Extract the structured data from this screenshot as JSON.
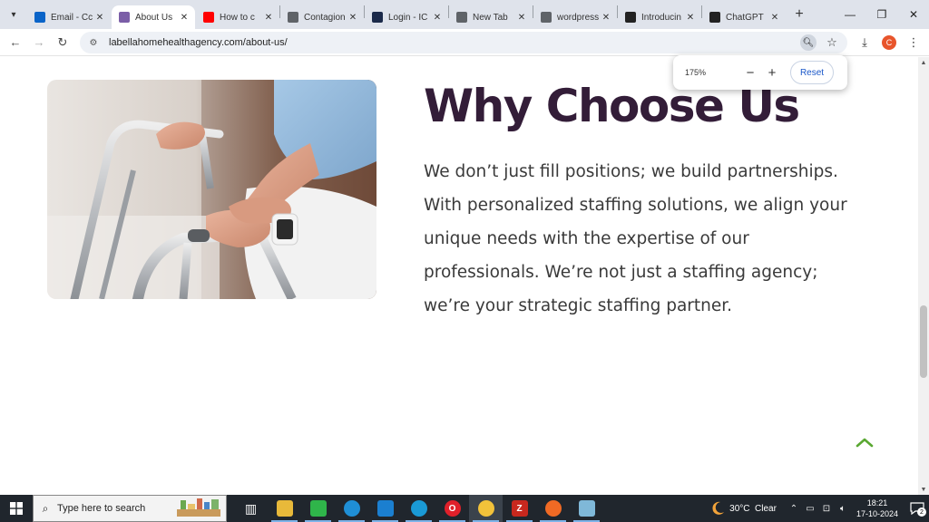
{
  "browser": {
    "tabs": [
      {
        "label": "Email - Cc",
        "favicon": "outlook-icon",
        "color": "#0a64c8",
        "active": false
      },
      {
        "label": "About Us",
        "favicon": "lotus-logo-icon",
        "color": "#7b5ea7",
        "active": true
      },
      {
        "label": "How to c",
        "favicon": "youtube-icon",
        "color": "#ff0000",
        "active": false
      },
      {
        "label": "Contagion",
        "favicon": "globe-icon",
        "color": "#5f6368",
        "active": false
      },
      {
        "label": "Login - IC",
        "favicon": "n-logo-icon",
        "color": "#1b2a4a",
        "active": false
      },
      {
        "label": "New Tab",
        "favicon": "chrome-icon",
        "color": "#5f6368",
        "active": false
      },
      {
        "label": "wordpress",
        "favicon": "globe-icon",
        "color": "#5f6368",
        "active": false
      },
      {
        "label": "Introducin",
        "favicon": "openai-icon",
        "color": "#222222",
        "active": false
      },
      {
        "label": "ChatGPT",
        "favicon": "openai-icon",
        "color": "#222222",
        "active": false
      }
    ],
    "tab_close": "✕",
    "new_tab": "+",
    "window_controls": {
      "minimize": "—",
      "restore": "❐",
      "close": "✕"
    },
    "url": "labellahomehealthagency.com/about-us/",
    "profile_initial": "C",
    "zoom_popup": {
      "value": "175%",
      "minus": "−",
      "plus": "+",
      "reset_label": "Reset"
    }
  },
  "page": {
    "heading": "Why Choose Us",
    "body": "We don’t just fill positions; we build partnerships. With personalized staffing solutions, we align your unique needs with the expertise of our professionals. We’re not just a staffing agency; we’re your strategic staffing partner.",
    "accent_color": "#5aa832",
    "heading_color": "#331d38"
  },
  "taskbar": {
    "search_placeholder": "Type here to search",
    "apps": [
      {
        "name": "task-view-icon",
        "open": false
      },
      {
        "name": "file-explorer-icon",
        "open": true
      },
      {
        "name": "whatsapp-icon",
        "open": true
      },
      {
        "name": "teams-icon",
        "open": true
      },
      {
        "name": "vscode-icon",
        "open": true
      },
      {
        "name": "edge-icon",
        "open": true
      },
      {
        "name": "opera-icon",
        "open": true
      },
      {
        "name": "chrome-icon",
        "open": true
      },
      {
        "name": "filezilla-icon",
        "open": true
      },
      {
        "name": "firefox-icon",
        "open": true
      },
      {
        "name": "notepad-icon",
        "open": true
      }
    ],
    "weather": "30°C  Clear",
    "time": "18:21",
    "date": "17-10-2024",
    "notification_count": "2"
  }
}
